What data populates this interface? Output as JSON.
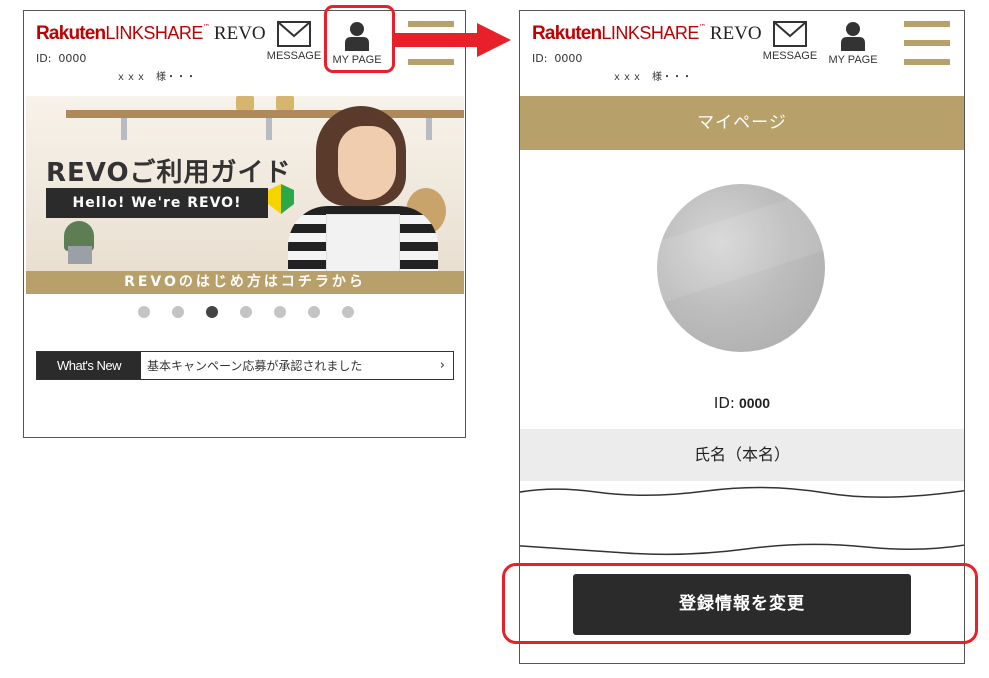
{
  "colors": {
    "brand_red": "#bf0000",
    "gold": "#b8a06a",
    "dark": "#2b2b2b",
    "highlight_red": "#e8202a"
  },
  "header": {
    "logo_rakuten": "Rakuten",
    "logo_linkshare": "LINKSHARE",
    "logo_tm": "™",
    "logo_revo": "REVO",
    "id_label": "ID:",
    "id_value": "0000",
    "name_text": "ｘｘｘ　様・・・",
    "message_label": "MESSAGE",
    "mypage_label": "MY PAGE",
    "message_icon": "envelope-icon",
    "mypage_icon": "user-icon",
    "menu_icon": "hamburger-icon"
  },
  "left_screen": {
    "banner": {
      "title": "REVOご利用ガイド",
      "tagline": "Hello! We're REVO!",
      "strip_text": "REVOのはじめ方はコチラから"
    },
    "carousel": {
      "count": 7,
      "active_index": 2
    },
    "whats_new": {
      "label": "What's New",
      "text": "基本キャンペーン応募が承認されました",
      "chevron": "›"
    }
  },
  "right_screen": {
    "page_title": "マイページ",
    "id_label": "ID:",
    "id_value": "0000",
    "name_field": "氏名（本名）",
    "edit_button": "登録情報を変更"
  }
}
